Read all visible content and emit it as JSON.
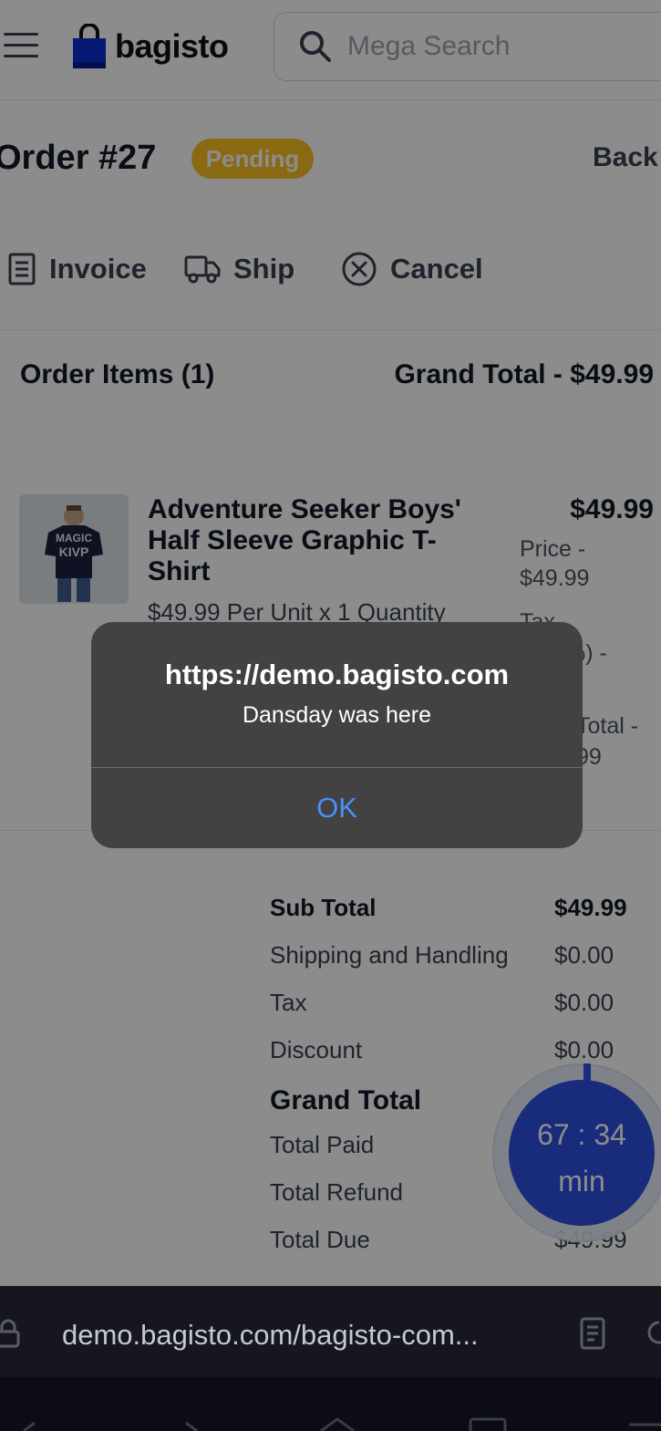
{
  "header": {
    "logo_text": "bagisto",
    "search_placeholder": "Mega Search"
  },
  "order": {
    "title": "Order #27",
    "status": "Pending",
    "back_label": "Back"
  },
  "actions": {
    "invoice": "Invoice",
    "ship": "Ship",
    "cancel": "Cancel"
  },
  "items": {
    "heading": "Order Items (1)",
    "grand_total": "Grand Total - $49.99",
    "product": {
      "name": "Adventure Seeker Boys' Half Sleeve Graphic T-Shirt",
      "unit_line": "$49.99 Per Unit x 1 Quantity",
      "price": "$49.99",
      "price_line_1": "Price -",
      "price_line_2": "$49.99",
      "tax_line_1": "Tax",
      "tax_line_2": "%) -",
      "tax_line_3": "0",
      "subtotal_line_1": "Total -",
      "subtotal_line_2": "99"
    }
  },
  "summary": {
    "rows": [
      {
        "label": "Sub Total",
        "value": "$49.99"
      },
      {
        "label": "Shipping and Handling",
        "value": "$0.00"
      },
      {
        "label": "Tax",
        "value": "$0.00"
      },
      {
        "label": "Discount",
        "value": "$0.00"
      },
      {
        "label": "Grand Total",
        "value": ""
      },
      {
        "label": "Total Paid",
        "value": ""
      },
      {
        "label": "Total Refund",
        "value": ""
      },
      {
        "label": "Total Due",
        "value": "$49.99"
      }
    ]
  },
  "timer": {
    "time": "67 : 34",
    "unit": "min"
  },
  "alert": {
    "title": "https://demo.bagisto.com",
    "message": "Dansday was here",
    "ok_label": "OK"
  },
  "browser": {
    "url": "demo.bagisto.com/bagisto-com..."
  },
  "colors": {
    "accent": "#2f4fe0",
    "badge": "#fbbf24",
    "alert_button": "#4a90f5"
  }
}
